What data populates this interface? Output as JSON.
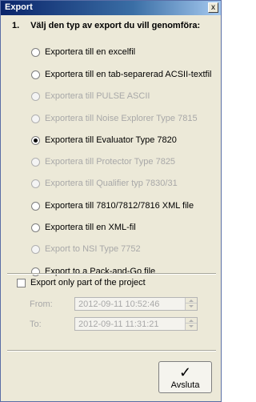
{
  "window": {
    "title": "Export",
    "close_glyph": "x"
  },
  "step": {
    "number": "1.",
    "text": "Välj den typ av export du vill genomföra:"
  },
  "options": [
    {
      "label": "Exportera till en excelfil",
      "enabled": true,
      "checked": false
    },
    {
      "label": "Exportera till en tab-separerad ACSII-textfil",
      "enabled": true,
      "checked": false
    },
    {
      "label": "Exportera till PULSE ASCII",
      "enabled": false,
      "checked": false
    },
    {
      "label": "Exportera till Noise Explorer Type 7815",
      "enabled": false,
      "checked": false
    },
    {
      "label": "Exportera till Evaluator Type 7820",
      "enabled": true,
      "checked": true
    },
    {
      "label": "Exportera till Protector Type 7825",
      "enabled": false,
      "checked": false
    },
    {
      "label": "Exportera till Qualifier typ 7830/31",
      "enabled": false,
      "checked": false
    },
    {
      "label": "Exportera till 7810/7812/7816 XML file",
      "enabled": true,
      "checked": false
    },
    {
      "label": "Exportera till en XML-fil",
      "enabled": true,
      "checked": false
    },
    {
      "label": "Export to NSI Type 7752",
      "enabled": false,
      "checked": false
    },
    {
      "label": "Export to a Pack-and-Go file",
      "enabled": true,
      "checked": false
    }
  ],
  "partial": {
    "checkbox_label": "Export only part of the project",
    "from_label": "From:",
    "from_value": "2012-09-11 10:52:46",
    "to_label": "To:",
    "to_value": "2012-09-11 11:31:21"
  },
  "footer": {
    "button_label": "Avsluta",
    "button_icon": "checkmark-icon"
  }
}
